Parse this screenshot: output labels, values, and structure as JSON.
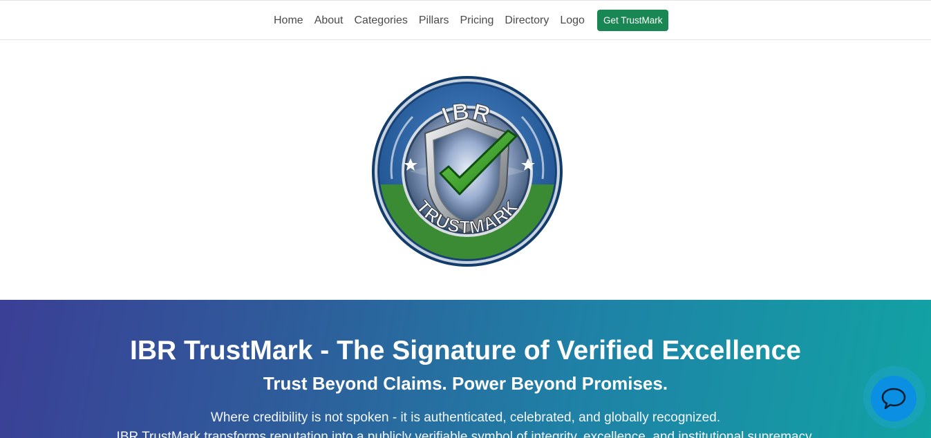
{
  "nav": {
    "items": [
      {
        "label": "Home"
      },
      {
        "label": "About"
      },
      {
        "label": "Categories"
      },
      {
        "label": "Pillars"
      },
      {
        "label": "Pricing"
      },
      {
        "label": "Directory"
      },
      {
        "label": "Logo"
      }
    ],
    "cta_label": "Get TrustMark"
  },
  "logo": {
    "top_text": "IBR",
    "bottom_text": "TRUSTMARK",
    "icon": "shield-check-icon"
  },
  "hero": {
    "title": "IBR TrustMark - The Signature of Verified Excellence",
    "subtitle": "Trust Beyond Claims. Power Beyond Promises.",
    "desc_line1": "Where credibility is not spoken - it is authenticated, celebrated, and globally recognized.",
    "desc_line2": "IBR TrustMark transforms reputation into a publicly verifiable symbol of integrity, excellence, and institutional supremacy."
  },
  "chat": {
    "icon": "chat-bubble-icon"
  },
  "colors": {
    "cta_green": "#198754",
    "hero_gradient_start": "#3b3f96",
    "hero_gradient_end": "#12a3a4",
    "chat_blue": "#0a8fe3",
    "badge_blue": "#2d64a6",
    "badge_green": "#3b8a34"
  }
}
